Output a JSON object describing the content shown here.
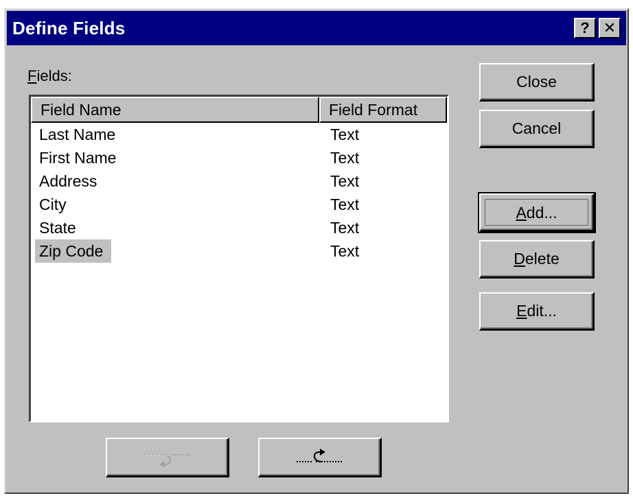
{
  "window": {
    "title": "Define Fields",
    "help_button": "?",
    "close_button": "✕"
  },
  "fields_label": {
    "mnemonic": "F",
    "rest": "ields:"
  },
  "table": {
    "columns": [
      "Field Name",
      "Field Format"
    ],
    "rows": [
      {
        "name": "Last Name",
        "format": "Text"
      },
      {
        "name": "First Name",
        "format": "Text"
      },
      {
        "name": "Address",
        "format": "Text"
      },
      {
        "name": "City",
        "format": "Text"
      },
      {
        "name": "State",
        "format": "Text"
      },
      {
        "name": "Zip Code",
        "format": "Text"
      }
    ],
    "selected_row": "Zip Code"
  },
  "buttons": {
    "close": "Close",
    "cancel": "Cancel",
    "add": {
      "mnemonic": "A",
      "rest": "dd..."
    },
    "delete": {
      "mnemonic": "D",
      "rest": "elete"
    },
    "edit": {
      "mnemonic": "E",
      "rest": "dit..."
    }
  },
  "bottom_buttons": {
    "move_down_icon": "arrow-right-hook-icon",
    "move_up_icon": "arrow-left-hook-icon",
    "move_down_enabled": false,
    "move_up_enabled": true
  },
  "colors": {
    "titlebar": "#000080",
    "face": "#c0c0c0",
    "selection": "#c0c0c0"
  }
}
